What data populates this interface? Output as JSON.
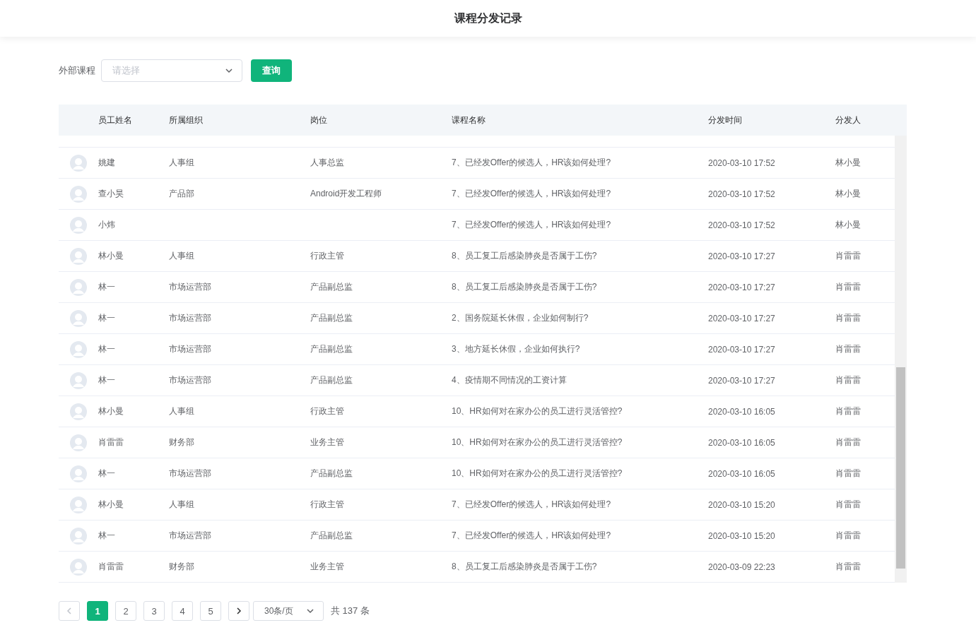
{
  "header": {
    "title": "课程分发记录"
  },
  "filter": {
    "label": "外部课程",
    "select": {
      "placeholder": "请选择"
    },
    "button": "查询"
  },
  "table": {
    "columns": [
      "员工姓名",
      "所属组织",
      "岗位",
      "课程名称",
      "分发时间",
      "分发人"
    ],
    "rows": [
      {
        "name": "姚建",
        "org": "人事组",
        "post": "人事总监",
        "course": "7、已经发Offer的候选人，HR该如何处理?",
        "time": "2020-03-10 17:52",
        "sender": "林小曼"
      },
      {
        "name": "查小昊",
        "org": "产品部",
        "post": "Android开发工程师",
        "course": "7、已经发Offer的候选人，HR该如何处理?",
        "time": "2020-03-10 17:52",
        "sender": "林小曼"
      },
      {
        "name": "小炜",
        "course": "7、已经发Offer的候选人，HR该如何处理?",
        "time": "2020-03-10 17:52",
        "sender": "林小曼"
      },
      {
        "name": "林小曼",
        "org": "人事组",
        "post": "行政主管",
        "course": "8、员工复工后感染肺炎是否属于工伤?",
        "time": "2020-03-10 17:27",
        "sender": "肖雷雷"
      },
      {
        "name": "林一",
        "org": "市场运营部",
        "post": "产品副总监",
        "course": "8、员工复工后感染肺炎是否属于工伤?",
        "time": "2020-03-10 17:27",
        "sender": "肖雷雷"
      },
      {
        "name": "林一",
        "org": "市场运营部",
        "post": "产品副总监",
        "course": "2、国务院延长休假，企业如何制行?",
        "time": "2020-03-10 17:27",
        "sender": "肖雷雷"
      },
      {
        "name": "林一",
        "org": "市场运营部",
        "post": "产品副总监",
        "course": "3、地方延长休假，企业如何执行?",
        "time": "2020-03-10 17:27",
        "sender": "肖雷雷"
      },
      {
        "name": "林一",
        "org": "市场运营部",
        "post": "产品副总监",
        "course": "4、疫情期不同情况的工资计算",
        "time": "2020-03-10 17:27",
        "sender": "肖雷雷"
      },
      {
        "name": "林小曼",
        "org": "人事组",
        "post": "行政主管",
        "course": "10、HR如何对在家办公的员工进行灵活管控?",
        "time": "2020-03-10 16:05",
        "sender": "肖雷雷"
      },
      {
        "name": "肖雷雷",
        "org": "财务部",
        "post": "业务主管",
        "course": "10、HR如何对在家办公的员工进行灵活管控?",
        "time": "2020-03-10 16:05",
        "sender": "肖雷雷"
      },
      {
        "name": "林一",
        "org": "市场运营部",
        "post": "产品副总监",
        "course": "10、HR如何对在家办公的员工进行灵活管控?",
        "time": "2020-03-10 16:05",
        "sender": "肖雷雷"
      },
      {
        "name": "林小曼",
        "org": "人事组",
        "post": "行政主管",
        "course": "7、已经发Offer的候选人，HR该如何处理?",
        "time": "2020-03-10 15:20",
        "sender": "肖雷雷"
      },
      {
        "name": "林一",
        "org": "市场运营部",
        "post": "产品副总监",
        "course": "7、已经发Offer的候选人，HR该如何处理?",
        "time": "2020-03-10 15:20",
        "sender": "肖雷雷"
      },
      {
        "name": "肖雷雷",
        "org": "财务部",
        "post": "业务主管",
        "course": "8、员工复工后感染肺炎是否属于工伤?",
        "time": "2020-03-09 22:23",
        "sender": "肖雷雷"
      }
    ]
  },
  "pagination": {
    "pages": [
      {
        "label": "1",
        "selected": true
      },
      {
        "label": "2",
        "selected": false
      },
      {
        "label": "3",
        "selected": false
      },
      {
        "label": "4",
        "selected": false
      },
      {
        "label": "5",
        "selected": false
      }
    ],
    "prev_disabled": true,
    "page_size": "30条/页",
    "total": "共 137 条"
  }
}
